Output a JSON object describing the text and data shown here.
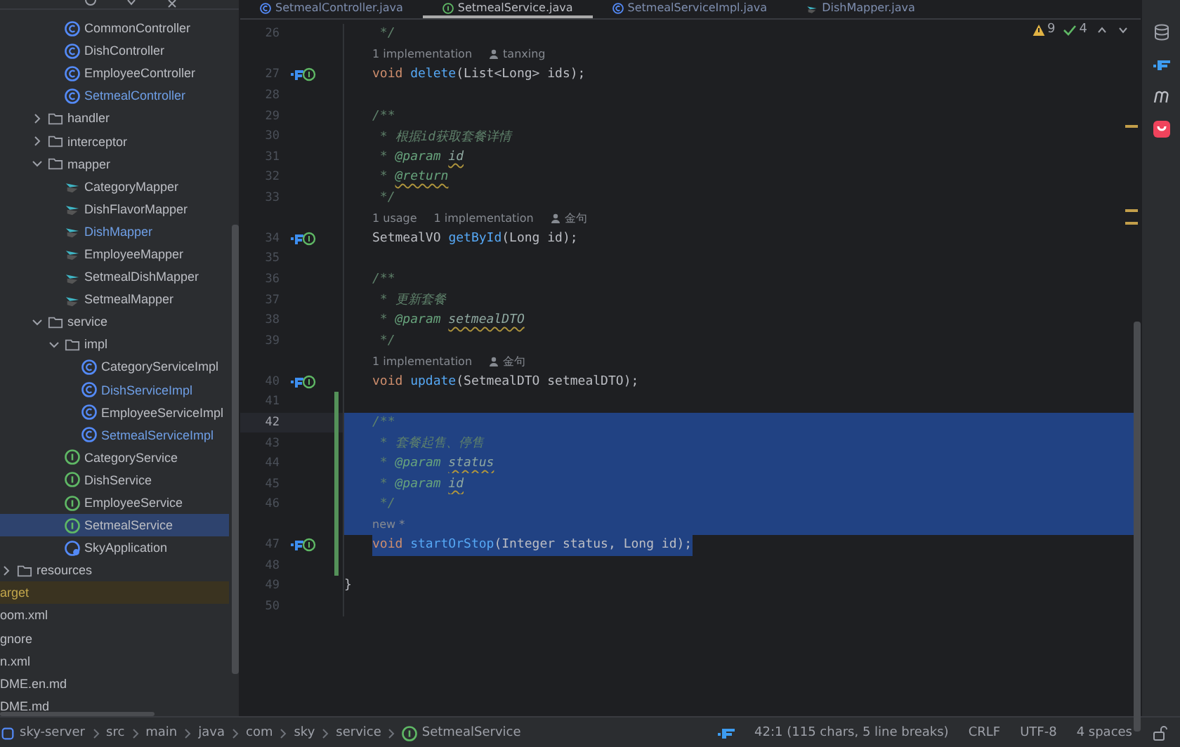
{
  "tabs": [
    {
      "label": "SetmealController.java",
      "kind": "class",
      "selected": false
    },
    {
      "label": "SetmealService.java",
      "kind": "interface",
      "selected": true
    },
    {
      "label": "SetmealServiceImpl.java",
      "kind": "class",
      "selected": false
    },
    {
      "label": "DishMapper.java",
      "kind": "mapper",
      "selected": false
    }
  ],
  "tree": [
    {
      "label": "CommonController",
      "kind": "class",
      "modified": false,
      "ignored": false,
      "selected": false
    },
    {
      "label": "DishController",
      "kind": "class",
      "modified": false,
      "ignored": false,
      "selected": false
    },
    {
      "label": "EmployeeController",
      "kind": "class",
      "modified": false,
      "ignored": false,
      "selected": false
    },
    {
      "label": "SetmealController",
      "kind": "class",
      "modified": true,
      "ignored": false,
      "selected": false
    },
    {
      "label": "handler",
      "kind": "folder",
      "modified": false,
      "ignored": false,
      "selected": false,
      "expanded": false
    },
    {
      "label": "interceptor",
      "kind": "folder",
      "modified": false,
      "ignored": false,
      "selected": false,
      "expanded": false
    },
    {
      "label": "mapper",
      "kind": "folder",
      "modified": false,
      "ignored": false,
      "selected": false,
      "expanded": true,
      "children": [
        {
          "label": "CategoryMapper",
          "kind": "mapper",
          "modified": false,
          "ignored": false,
          "selected": false
        },
        {
          "label": "DishFlavorMapper",
          "kind": "mapper",
          "modified": false,
          "ignored": false,
          "selected": false
        },
        {
          "label": "DishMapper",
          "kind": "mapper",
          "modified": true,
          "ignored": false,
          "selected": false
        },
        {
          "label": "EmployeeMapper",
          "kind": "mapper",
          "modified": false,
          "ignored": false,
          "selected": false
        },
        {
          "label": "SetmealDishMapper",
          "kind": "mapper",
          "modified": false,
          "ignored": false,
          "selected": false
        },
        {
          "label": "SetmealMapper",
          "kind": "mapper",
          "modified": false,
          "ignored": false,
          "selected": false
        }
      ]
    },
    {
      "label": "service",
      "kind": "folder",
      "modified": false,
      "ignored": false,
      "selected": false,
      "expanded": true,
      "children": [
        {
          "label": "impl",
          "kind": "folder",
          "modified": false,
          "ignored": false,
          "selected": false,
          "expanded": true,
          "children": [
            {
              "label": "CategoryServiceImpl",
              "kind": "class",
              "modified": false,
              "ignored": false,
              "selected": false
            },
            {
              "label": "DishServiceImpl",
              "kind": "class",
              "modified": true,
              "ignored": false,
              "selected": false
            },
            {
              "label": "EmployeeServiceImpl",
              "kind": "class",
              "modified": false,
              "ignored": false,
              "selected": false
            },
            {
              "label": "SetmealServiceImpl",
              "kind": "class",
              "modified": true,
              "ignored": false,
              "selected": false
            }
          ]
        },
        {
          "label": "CategoryService",
          "kind": "interface",
          "modified": false,
          "ignored": false,
          "selected": false
        },
        {
          "label": "DishService",
          "kind": "interface",
          "modified": false,
          "ignored": false,
          "selected": false
        },
        {
          "label": "EmployeeService",
          "kind": "interface",
          "modified": false,
          "ignored": false,
          "selected": false
        },
        {
          "label": "SetmealService",
          "kind": "interface",
          "modified": false,
          "ignored": false,
          "selected": true
        }
      ]
    },
    {
      "label": "SkyApplication",
      "kind": "app",
      "modified": false,
      "ignored": false,
      "selected": false
    },
    {
      "label": "resources",
      "kind": "folder",
      "modified": false,
      "ignored": false,
      "selected": false,
      "expanded": false
    },
    {
      "label": "arget",
      "kind": "file",
      "modified": false,
      "ignored": true,
      "selected": false
    },
    {
      "label": "oom.xml",
      "kind": "file",
      "modified": false,
      "ignored": false,
      "selected": false
    },
    {
      "label": "gnore",
      "kind": "file",
      "modified": false,
      "ignored": false,
      "selected": false
    },
    {
      "label": "n.xml",
      "kind": "file",
      "modified": false,
      "ignored": false,
      "selected": false
    },
    {
      "label": "DME.en.md",
      "kind": "file",
      "modified": false,
      "ignored": false,
      "selected": false
    },
    {
      "label": "DME.md",
      "kind": "file",
      "modified": false,
      "ignored": false,
      "selected": false
    }
  ],
  "inspections": {
    "warnings": "9",
    "checks": "4"
  },
  "lines": [
    {
      "kind": "code",
      "number": "26",
      "tokens": [
        {
          "text": " */",
          "kind": "cmt"
        }
      ]
    },
    {
      "kind": "hint",
      "hints": [
        {
          "text": "1 implementation",
          "kind": "text"
        },
        {
          "text": "tanxing",
          "kind": "author"
        }
      ]
    },
    {
      "kind": "code",
      "number": "27",
      "marker": true,
      "tokens": [
        {
          "text": "void ",
          "kind": "kw"
        },
        {
          "text": "delete",
          "kind": "fn"
        },
        {
          "text": "(List<Long> ids);",
          "kind": "plain"
        }
      ]
    },
    {
      "kind": "code",
      "number": "28"
    },
    {
      "kind": "code",
      "number": "29",
      "tokens": [
        {
          "text": "/**",
          "kind": "cmt"
        }
      ]
    },
    {
      "kind": "code",
      "number": "30",
      "tokens": [
        {
          "text": " * 根据id获取套餐详情",
          "kind": "cmt"
        }
      ]
    },
    {
      "kind": "code",
      "number": "31",
      "tokens": [
        {
          "text": " * ",
          "kind": "cmt"
        },
        {
          "text": "@param",
          "kind": "tag"
        },
        {
          "text": "id",
          "kind": "ref"
        }
      ]
    },
    {
      "kind": "code",
      "number": "32",
      "tokens": [
        {
          "text": " * ",
          "kind": "cmt"
        },
        {
          "text": "@return",
          "kind": "tagref"
        }
      ]
    },
    {
      "kind": "code",
      "number": "33",
      "tokens": [
        {
          "text": " */",
          "kind": "cmt"
        }
      ]
    },
    {
      "kind": "hint",
      "hints": [
        {
          "text": "1 usage",
          "kind": "text"
        },
        {
          "text": "1 implementation",
          "kind": "text"
        },
        {
          "text": "金句",
          "kind": "author"
        }
      ]
    },
    {
      "kind": "code",
      "number": "34",
      "marker": true,
      "tokens": [
        {
          "text": "SetmealVO ",
          "kind": "plain"
        },
        {
          "text": "getById",
          "kind": "fn"
        },
        {
          "text": "(Long id);",
          "kind": "plain"
        }
      ]
    },
    {
      "kind": "code",
      "number": "35"
    },
    {
      "kind": "code",
      "number": "36",
      "tokens": [
        {
          "text": "/**",
          "kind": "cmt"
        }
      ]
    },
    {
      "kind": "code",
      "number": "37",
      "tokens": [
        {
          "text": " * 更新套餐",
          "kind": "cmt"
        }
      ]
    },
    {
      "kind": "code",
      "number": "38",
      "tokens": [
        {
          "text": " * ",
          "kind": "cmt"
        },
        {
          "text": "@param",
          "kind": "tag"
        },
        {
          "text": "setmealDTO",
          "kind": "ref"
        }
      ]
    },
    {
      "kind": "code",
      "number": "39",
      "tokens": [
        {
          "text": " */",
          "kind": "cmt"
        }
      ]
    },
    {
      "kind": "hint",
      "hints": [
        {
          "text": "1 implementation",
          "kind": "text"
        },
        {
          "text": "金句",
          "kind": "author"
        }
      ]
    },
    {
      "kind": "code",
      "number": "40",
      "marker": true,
      "tokens": [
        {
          "text": "void ",
          "kind": "kw"
        },
        {
          "text": "update",
          "kind": "fn"
        },
        {
          "text": "(SetmealDTO setmealDTO);",
          "kind": "plain"
        }
      ]
    },
    {
      "kind": "code",
      "number": "41",
      "changed": true
    },
    {
      "kind": "code",
      "number": "42",
      "changed": true,
      "current": true,
      "selected": true,
      "tokens": [
        {
          "text": "/**",
          "kind": "cmt"
        }
      ]
    },
    {
      "kind": "code",
      "number": "43",
      "changed": true,
      "selected": true,
      "tokens": [
        {
          "text": " * 套餐起售、停售",
          "kind": "cmt"
        }
      ]
    },
    {
      "kind": "code",
      "number": "44",
      "changed": true,
      "selected": true,
      "tokens": [
        {
          "text": " * ",
          "kind": "cmt"
        },
        {
          "text": "@param",
          "kind": "tag"
        },
        {
          "text": "status",
          "kind": "ref"
        }
      ]
    },
    {
      "kind": "code",
      "number": "45",
      "changed": true,
      "selected": true,
      "tokens": [
        {
          "text": " * ",
          "kind": "cmt"
        },
        {
          "text": "@param",
          "kind": "tag"
        },
        {
          "text": "id",
          "kind": "ref"
        }
      ]
    },
    {
      "kind": "code",
      "number": "46",
      "changed": true,
      "selected": true,
      "tokens": [
        {
          "text": " */",
          "kind": "cmt"
        }
      ]
    },
    {
      "kind": "hint",
      "changed": true,
      "selected": true,
      "hints": [
        {
          "text": "new *",
          "kind": "text"
        }
      ]
    },
    {
      "kind": "code",
      "number": "47",
      "marker": true,
      "changed": true,
      "selected": true,
      "tokens": [
        {
          "text": "void ",
          "kind": "kw"
        },
        {
          "text": "startOrStop",
          "kind": "fn"
        },
        {
          "text": "(Integer status, Long id);",
          "kind": "plain"
        }
      ]
    },
    {
      "kind": "code",
      "number": "48",
      "changed": true
    },
    {
      "kind": "code",
      "number": "49",
      "outdent": true,
      "tokens": [
        {
          "text": "}",
          "kind": "plain"
        }
      ]
    },
    {
      "kind": "code",
      "number": "50"
    }
  ],
  "breadcrumb": [
    {
      "label": "sky-server",
      "kind": "module"
    },
    {
      "label": "src",
      "kind": "folder"
    },
    {
      "label": "main",
      "kind": "folder"
    },
    {
      "label": "java",
      "kind": "folder"
    },
    {
      "label": "com",
      "kind": "folder"
    },
    {
      "label": "sky",
      "kind": "folder"
    },
    {
      "label": "service",
      "kind": "folder"
    },
    {
      "label": "SetmealService",
      "kind": "interface"
    }
  ],
  "status_bar": {
    "position": "42:1 (115 chars, 5 line breaks)",
    "line_separator": "CRLF",
    "encoding": "UTF-8",
    "indent": "4 spaces"
  }
}
